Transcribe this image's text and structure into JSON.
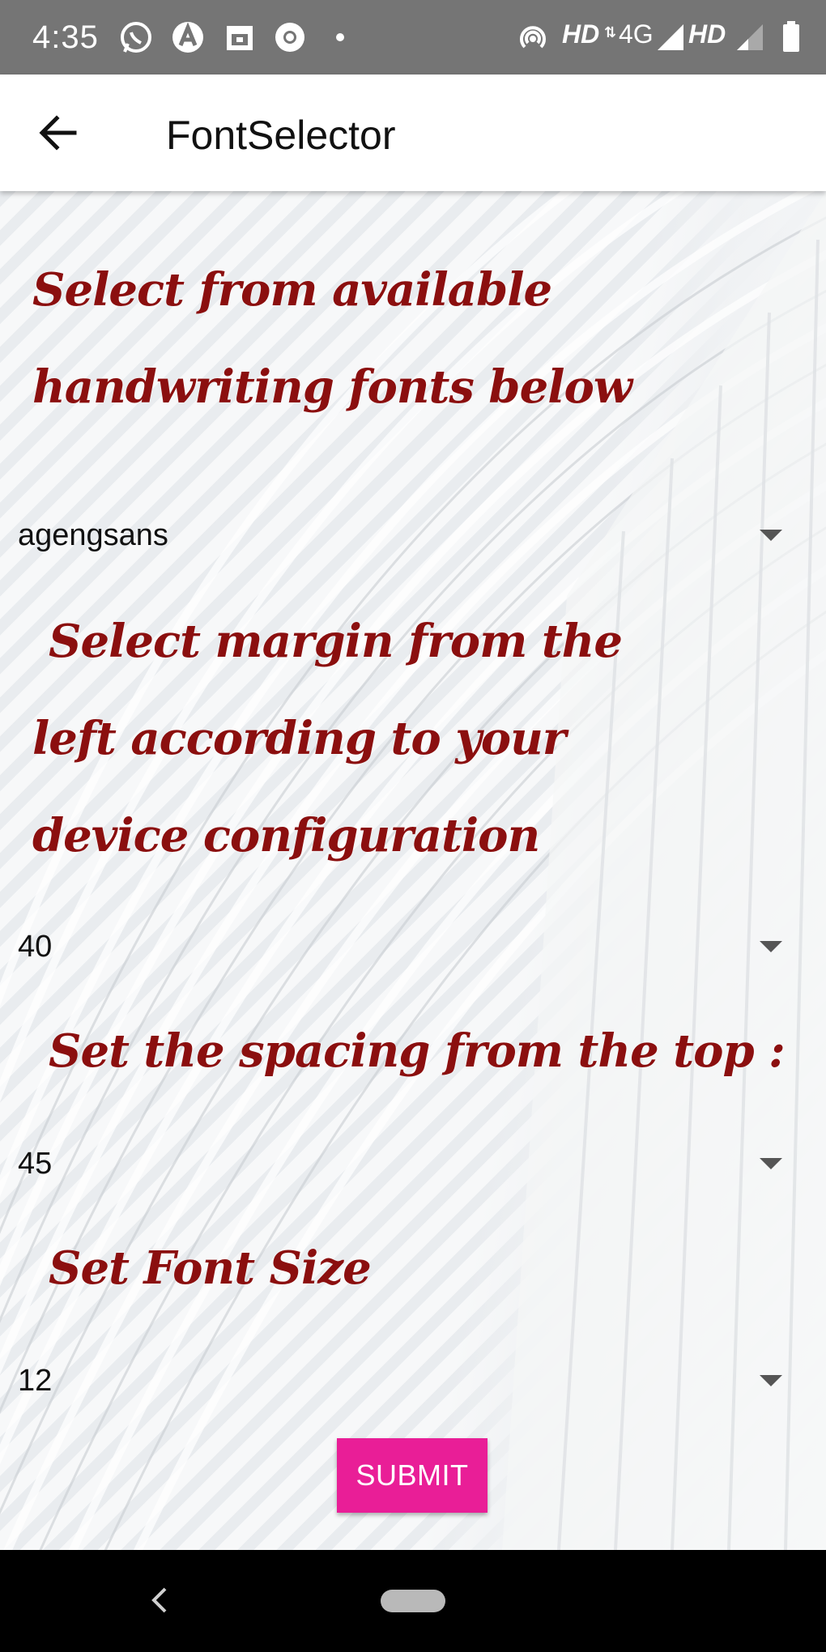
{
  "status_bar": {
    "time": "4:35",
    "network_label_1": "HD",
    "network_type": "4G",
    "network_label_2": "HD",
    "notification_icons": [
      "whatsapp-icon",
      "arrow-up-circle-icon",
      "calendar-icon",
      "chrome-icon",
      "dot-icon"
    ],
    "system_icons": [
      "hotspot-icon",
      "signal-icon",
      "signal-weak-icon",
      "battery-icon"
    ]
  },
  "app_bar": {
    "title": "FontSelector",
    "back_icon": "arrow-left-icon"
  },
  "sections": {
    "font_prompt": "Select from available handwriting fonts below",
    "font_value": "agengsans",
    "margin_prompt": "Select margin from the left according to your device configuration",
    "margin_value": "40",
    "spacing_prompt": "Set the spacing from the top :",
    "spacing_value": "45",
    "size_prompt": "Set Font Size",
    "size_value": "12"
  },
  "submit_label": "SUBMIT",
  "colors": {
    "heading_text": "#8b0f0f",
    "submit_button": "#e91e97",
    "status_bar": "#757575"
  },
  "nav_bar": {
    "back_icon": "chevron-left-icon",
    "home_icon": "home-pill-icon"
  }
}
